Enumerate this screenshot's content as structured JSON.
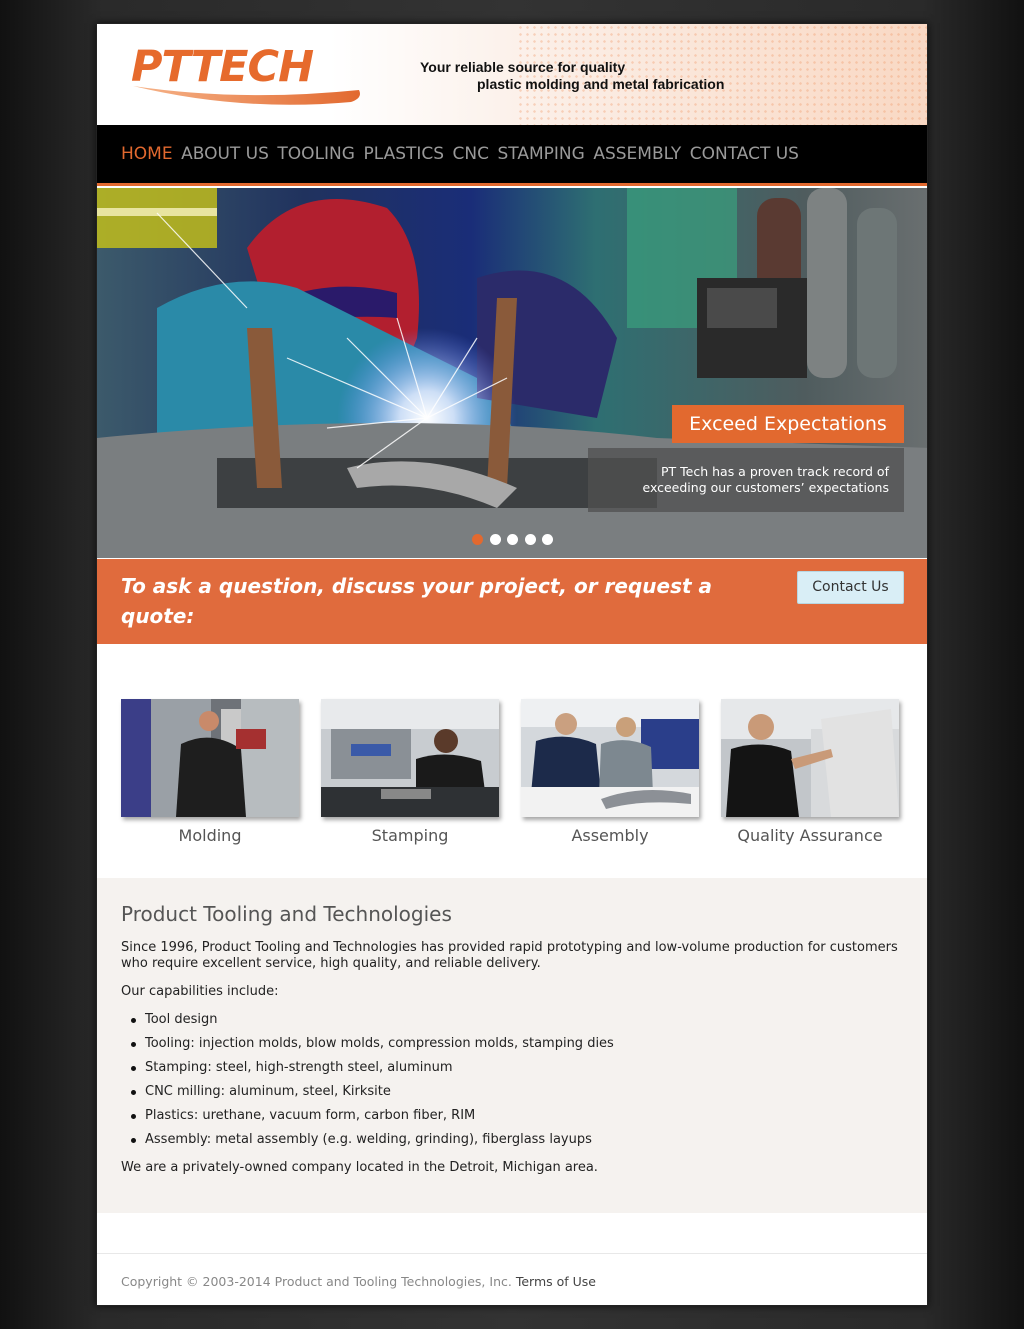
{
  "header": {
    "logo_text": "PTTECH",
    "tagline_line1": "Your reliable source for quality",
    "tagline_line2": "plastic molding and metal fabrication"
  },
  "nav": {
    "items": [
      {
        "label": "HOME",
        "active": true
      },
      {
        "label": "ABOUT US",
        "active": false
      },
      {
        "label": "TOOLING",
        "active": false
      },
      {
        "label": "PLASTICS",
        "active": false
      },
      {
        "label": "CNC",
        "active": false
      },
      {
        "label": "STAMPING",
        "active": false
      },
      {
        "label": "ASSEMBLY",
        "active": false
      },
      {
        "label": "CONTACT US",
        "active": false
      }
    ]
  },
  "hero": {
    "image": "welder-with-sparks-photo",
    "caption_title": "Exceed Expectations",
    "caption_line1": "PT Tech has a proven track record of",
    "caption_line2": "exceeding our customers’ expectations",
    "slide_count": 5,
    "active_slide": 1
  },
  "cta": {
    "text": "To ask a question, discuss your project, or request a quote:",
    "button_label": "Contact Us"
  },
  "services": [
    {
      "label": "Molding",
      "image": "molding-worker-photo"
    },
    {
      "label": "Stamping",
      "image": "stamping-worker-photo"
    },
    {
      "label": "Assembly",
      "image": "assembly-workers-photo"
    },
    {
      "label": "Quality Assurance",
      "image": "quality-assurance-worker-photo"
    }
  ],
  "about": {
    "title": "Product Tooling and Technologies",
    "intro": "Since 1996, Product Tooling and Technologies has provided rapid prototyping and low-volume production for customers who require excellent service, high quality, and reliable delivery.",
    "capabilities_intro": "Our capabilities include:",
    "capabilities": [
      "Tool design",
      "Tooling: injection molds, blow molds, compression molds, stamping dies",
      "Stamping: steel, high-strength steel, aluminum",
      "CNC milling: aluminum, steel, Kirksite",
      "Plastics: urethane, vacuum form, carbon fiber, RIM",
      "Assembly: metal assembly (e.g. welding, grinding), fiberglass layups"
    ],
    "closing": "We are a privately-owned company located in the Detroit, Michigan area."
  },
  "footer": {
    "copyright": "Copyright © 2003-2014 Product and Tooling Technologies, Inc.",
    "terms_label": "Terms of Use"
  },
  "colors": {
    "accent": "#e2692f",
    "cta_background": "#e06b3d",
    "nav_background": "#000000",
    "about_background": "#f5f2ef"
  }
}
